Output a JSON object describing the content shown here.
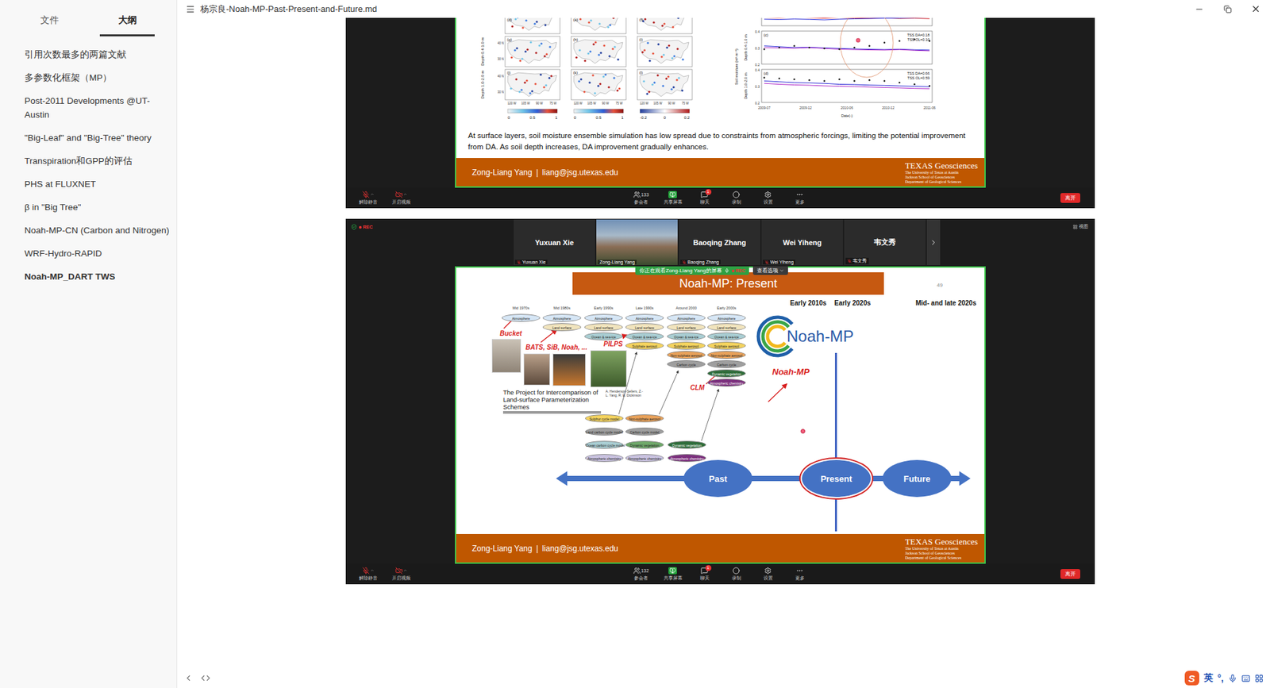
{
  "window": {
    "title": "杨宗良-Noah-MP-Past-Present-and-Future.md"
  },
  "sidebar": {
    "tabs": [
      {
        "label": "文件",
        "selected": false
      },
      {
        "label": "大纲",
        "selected": true
      }
    ],
    "items": [
      {
        "label": "引用次数最多的两篇文献",
        "selected": false
      },
      {
        "label": "多参数化框架（MP）",
        "selected": false
      },
      {
        "label": "Post-2011 Developments @UT-Austin",
        "selected": false
      },
      {
        "label": "\"Big-Leaf\" and \"Big-Tree\" theory",
        "selected": false
      },
      {
        "label": "Transpiration和GPP的评估",
        "selected": false
      },
      {
        "label": "PHS at FLUXNET",
        "selected": false
      },
      {
        "label": "β in \"Big Tree\"",
        "selected": false
      },
      {
        "label": "Noah-MP-CN (Carbon and Nitrogen)",
        "selected": false
      },
      {
        "label": "WRF-Hydro-RAPID",
        "selected": false
      },
      {
        "label": "Noah-MP_DART TWS",
        "selected": true
      }
    ]
  },
  "shots": [
    {
      "kind": "soil",
      "slide": {
        "maps": {
          "panels": [
            "(d)",
            "(e)",
            "(f)",
            "(g)",
            "(h)",
            "(i)",
            "(j)",
            "(k)",
            "(l)"
          ],
          "row_labels": [
            "Depth 0.4-1.0 m",
            "Depth 1.0-2.0 m"
          ],
          "lat_ticks": [
            "40 N",
            "30 N"
          ],
          "lon_ticks": [
            "120 W",
            "105 W",
            "90 W",
            "75 W"
          ],
          "colorbars": [
            {
              "kind": "sequential",
              "ticks": [
                "0",
                "0.5",
                "1"
              ]
            },
            {
              "kind": "sequential",
              "ticks": [
                "0",
                "0.5",
                "1"
              ]
            },
            {
              "kind": "diverging",
              "ticks": [
                "-0.2",
                "0",
                "0.2"
              ]
            }
          ]
        },
        "lines": {
          "y_label": "Soil moisture (m³ m⁻³)",
          "x_label": "Date(-)",
          "x_ticks": [
            "2009-07",
            "2009-12",
            "2010-06",
            "2010-12",
            "2011-06"
          ],
          "panels": [
            {
              "series": [
                {
                  "kind": "line",
                  "color": "#d62728",
                  "values": [
                    0.25,
                    0.248,
                    0.252,
                    0.249,
                    0.246,
                    0.25,
                    0.247,
                    0.245,
                    0.248,
                    0.244,
                    0.246,
                    0.243
                  ]
                },
                {
                  "kind": "line",
                  "color": "#2a2ad6",
                  "values": [
                    0.24,
                    0.238,
                    0.241,
                    0.239,
                    0.236,
                    0.24,
                    0.242,
                    0.244,
                    0.246,
                    0.247,
                    0.249,
                    0.25
                  ]
                }
              ]
            },
            {
              "tag": "(c)",
              "depth": "Depth 0.4-1.0 m",
              "y_ticks": [
                "0.4",
                "0.3",
                "0.2"
              ],
              "stats": [
                "TSS DA=0.18",
                "TSS OL=0.10"
              ],
              "series": [
                {
                  "kind": "line",
                  "color": "#2a2ad6",
                  "values": [
                    0.31,
                    0.305,
                    0.3,
                    0.302,
                    0.298,
                    0.295,
                    0.292,
                    0.29,
                    0.288,
                    0.29,
                    0.287,
                    0.285
                  ]
                },
                {
                  "kind": "line",
                  "color": "#b02cc8",
                  "values": [
                    0.3,
                    0.298,
                    0.296,
                    0.3,
                    0.295,
                    0.29,
                    0.288,
                    0.286,
                    0.285,
                    0.288,
                    0.283,
                    0.28
                  ]
                },
                {
                  "kind": "dots",
                  "color": "#111111",
                  "values": [
                    0.29,
                    0.3,
                    0.31,
                    0.3,
                    0.295,
                    0.29,
                    0.3,
                    0.31,
                    0.33,
                    0.34,
                    0.35,
                    0.34
                  ]
                }
              ]
            },
            {
              "tag": "(d)",
              "depth": "Depth 1.0-2.0 m",
              "y_ticks": [
                "0.4",
                "0.3",
                "0.2"
              ],
              "stats": [
                "TSS DA=0.66",
                "TSS OL=0.59"
              ],
              "series": [
                {
                  "kind": "line",
                  "color": "#2a2ad6",
                  "values": [
                    0.33,
                    0.325,
                    0.32,
                    0.318,
                    0.315,
                    0.31,
                    0.308,
                    0.305,
                    0.303,
                    0.3,
                    0.298,
                    0.295
                  ]
                },
                {
                  "kind": "line",
                  "color": "#b02cc8",
                  "values": [
                    0.315,
                    0.31,
                    0.306,
                    0.304,
                    0.3,
                    0.298,
                    0.296,
                    0.293,
                    0.29,
                    0.288,
                    0.285,
                    0.283
                  ]
                },
                {
                  "kind": "dots",
                  "color": "#111111",
                  "values": [
                    0.35,
                    0.345,
                    0.34,
                    0.335,
                    0.33,
                    0.34,
                    0.33,
                    0.335,
                    0.33,
                    0.32,
                    0.31,
                    0.3
                  ]
                }
              ]
            }
          ]
        },
        "caption": "At surface layers, soil moisture ensemble simulation has low spread due to constraints from atmospheric forcings, limiting the potential improvement from DA. As soil depth increases, DA improvement gradually enhances.",
        "footer": {
          "presenter": "Zong-Liang Yang",
          "separator": "|",
          "email": "liang@jsg.utexas.edu",
          "brand": "TEXAS Geosciences",
          "brand_lines": [
            "The University of Texas at Austin",
            "Jackson School of Geosciences",
            "Department of Geological Sciences"
          ]
        }
      },
      "toolbar": {
        "mute": "解除静音",
        "video": "开启视频",
        "participants": "参会者",
        "count": "133",
        "share": "共享屏幕",
        "chat": "聊天",
        "chat_badge": "1",
        "record": "录制",
        "settings": "设置",
        "more": "更多",
        "leave": "离开"
      }
    },
    {
      "kind": "timeline",
      "header": {
        "rec": "REC",
        "view": "视图",
        "participants": [
          {
            "name": "Yuxuan Xie",
            "video": false,
            "muted": true
          },
          {
            "name": "Zong-Liang Yang",
            "video": true,
            "muted": false
          },
          {
            "name": "Baoqing Zhang",
            "video": false,
            "muted": true
          },
          {
            "name": "Wei Yiheng",
            "video": false,
            "muted": true
          },
          {
            "name": "韦文秀",
            "video": false,
            "muted": true
          }
        ]
      },
      "banner": {
        "text": "你正在观看Zong-Liang Yang的屏幕",
        "rec": "REC",
        "options": "查看选项"
      },
      "slide": {
        "title": "Noah-MP: Present",
        "page": "49",
        "eras": [
          {
            "label": "Mid 1970s",
            "components": [
              {
                "label": "Atmosphere",
                "color": "#d6e6f5"
              }
            ]
          },
          {
            "label": "Mid 1980s",
            "components": [
              {
                "label": "Atmosphere",
                "color": "#d6e6f5"
              },
              {
                "label": "Land surface",
                "color": "#f1e4bd"
              }
            ]
          },
          {
            "label": "Early 1990s",
            "components": [
              {
                "label": "Atmosphere",
                "color": "#d6e6f5"
              },
              {
                "label": "Land surface",
                "color": "#f1e4bd"
              },
              {
                "label": "Ocean & sea-ice",
                "color": "#a9cdd2"
              }
            ]
          },
          {
            "label": "Late 1990s",
            "components": [
              {
                "label": "Atmosphere",
                "color": "#d6e6f5"
              },
              {
                "label": "Land surface",
                "color": "#f1e4bd"
              },
              {
                "label": "Ocean & sea-ice",
                "color": "#a9cdd2"
              },
              {
                "label": "Sulphate aerosol",
                "color": "#f4d35e"
              }
            ]
          },
          {
            "label": "Around 2000",
            "components": [
              {
                "label": "Atmosphere",
                "color": "#d6e6f5"
              },
              {
                "label": "Land surface",
                "color": "#f1e4bd"
              },
              {
                "label": "Ocean & sea-ice",
                "color": "#a9cdd2"
              },
              {
                "label": "Sulphate aerosol",
                "color": "#f4d35e"
              },
              {
                "label": "Non-sulphate aerosol",
                "color": "#e9a25a"
              },
              {
                "label": "Carbon cycle",
                "color": "#9e9e9e"
              }
            ]
          },
          {
            "label": "Early 2000s",
            "components": [
              {
                "label": "Atmosphere",
                "color": "#d6e6f5"
              },
              {
                "label": "Land surface",
                "color": "#f1e4bd"
              },
              {
                "label": "Ocean & sea-ice",
                "color": "#a9cdd2"
              },
              {
                "label": "Sulphate aerosol",
                "color": "#f4d35e"
              },
              {
                "label": "Non-sulphate aerosol",
                "color": "#e9a25a"
              },
              {
                "label": "Carbon cycle",
                "color": "#9e9e9e"
              },
              {
                "label": "Dynamic vegetation",
                "color": "#2f6d3b"
              },
              {
                "label": "Atmospheric chemistry",
                "color": "#7b2f7d"
              }
            ]
          }
        ],
        "side_models": [
          [
            {
              "label": "Sulphur cycle model",
              "color": "#f4d35e"
            },
            {
              "label": "Land carbon cycle model",
              "color": "#9e9e9e"
            },
            {
              "label": "Ocean carbon cycle model",
              "color": "#a9cdd2"
            },
            {
              "label": "Atmospheric chemistry",
              "color": "#c9c2e0"
            }
          ],
          [
            {
              "label": "Non-sulphate aerosol",
              "color": "#e9a25a"
            },
            {
              "label": "Carbon cycle model",
              "color": "#9e9e9e"
            },
            {
              "label": "Dynamic vegetation",
              "color": "#6fa86a"
            },
            {
              "label": "Atmospheric chemistry",
              "color": "#c9c2e0"
            }
          ],
          [
            {
              "label": "Dynamic vegetation",
              "color": "#2f6d3b"
            },
            {
              "label": "Atmospheric chemistry",
              "color": "#7b2f7d"
            }
          ]
        ],
        "later_eras": [
          "Early 2010s",
          "Early 2020s",
          "Mid- and late 2020s"
        ],
        "labels": {
          "bucket": "Bucket",
          "bats": "BATS, SiB, Noah, ...",
          "pilps": "PILPS",
          "clm": "CLM",
          "noahmp": "Noah-MP"
        },
        "logo_text": "Noah-MP",
        "project": "The Project for Intercomparison of Land-surface Parameterization Schemes",
        "authors": "A. Henderson-Sellers, Z.-L. Yang, R. E. Dickinson",
        "timeline": [
          {
            "label": "Past",
            "selected": false
          },
          {
            "label": "Present",
            "selected": true
          },
          {
            "label": "Future",
            "selected": false
          }
        ],
        "footer": {
          "presenter": "Zong-Liang Yang",
          "separator": "|",
          "email": "liang@jsg.utexas.edu",
          "brand": "TEXAS Geosciences",
          "brand_lines": [
            "The University of Texas at Austin",
            "Jackson School of Geosciences",
            "Department of Geological Sciences"
          ]
        }
      },
      "toolbar": {
        "mute": "解除静音",
        "video": "开启视频",
        "participants": "参会者",
        "count": "132",
        "share": "共享屏幕",
        "chat": "聊天",
        "chat_badge": "1",
        "record": "录制",
        "settings": "设置",
        "more": "更多",
        "leave": "离开"
      }
    }
  ],
  "ime": {
    "logo": "S",
    "mode": "英",
    "punct": "°,"
  }
}
